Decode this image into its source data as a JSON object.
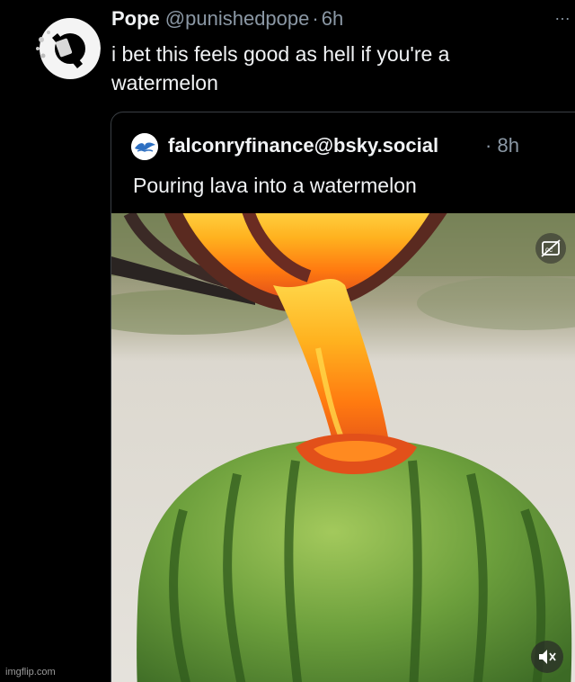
{
  "post": {
    "author_name": "Pope",
    "author_handle": "@punishedpope",
    "separator": "·",
    "time": "6h",
    "more_icon": "…",
    "text": "i bet this feels good as hell if you're a watermelon"
  },
  "quote": {
    "author": "falconryfinance@bsky.social",
    "separator": "·",
    "time": "8h",
    "text": "Pouring lava into a watermelon"
  },
  "video": {
    "captions_icon": "captions-off-icon",
    "mute_icon": "speaker-muted-icon"
  },
  "watermark": "imgflip.com",
  "colors": {
    "background": "#000000",
    "text": "#f1f3f5",
    "secondary": "#8b98a5",
    "border": "#3a3f44",
    "lava": "#ff7a10",
    "watermelon": "#4f8a30"
  }
}
